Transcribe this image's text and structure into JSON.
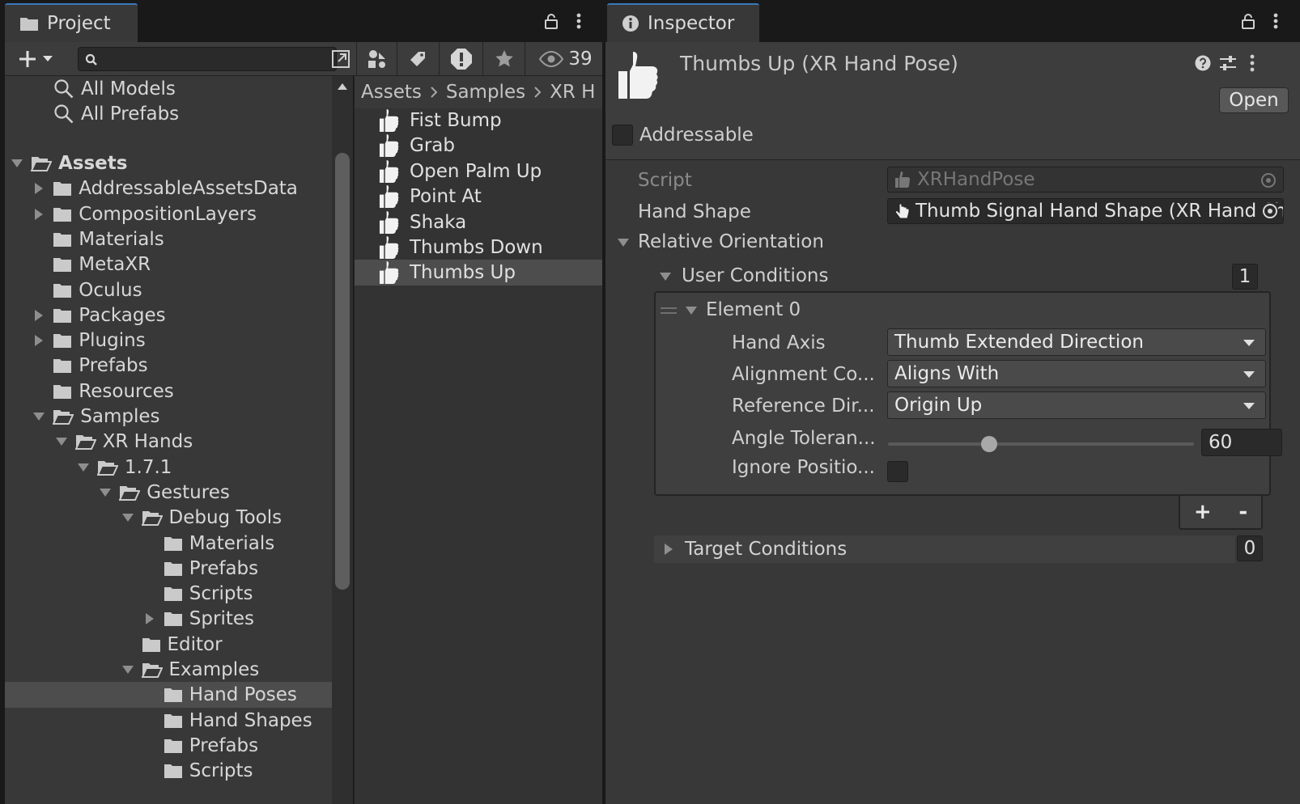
{
  "project": {
    "tab_label": "Project",
    "search": {
      "value": "",
      "placeholder": ""
    },
    "hidden_count": "39",
    "search_items": [
      {
        "label": "All Models"
      },
      {
        "label": "All Prefabs"
      }
    ],
    "tree": [
      {
        "label": "Assets",
        "depth": 0,
        "expand": "open",
        "bold": true
      },
      {
        "label": "AddressableAssetsData",
        "depth": 1,
        "expand": "closed"
      },
      {
        "label": "CompositionLayers",
        "depth": 1,
        "expand": "closed"
      },
      {
        "label": "Materials",
        "depth": 1,
        "expand": "none"
      },
      {
        "label": "MetaXR",
        "depth": 1,
        "expand": "none"
      },
      {
        "label": "Oculus",
        "depth": 1,
        "expand": "none"
      },
      {
        "label": "Packages",
        "depth": 1,
        "expand": "closed"
      },
      {
        "label": "Plugins",
        "depth": 1,
        "expand": "closed"
      },
      {
        "label": "Prefabs",
        "depth": 1,
        "expand": "none"
      },
      {
        "label": "Resources",
        "depth": 1,
        "expand": "none"
      },
      {
        "label": "Samples",
        "depth": 1,
        "expand": "open"
      },
      {
        "label": "XR Hands",
        "depth": 2,
        "expand": "open"
      },
      {
        "label": "1.7.1",
        "depth": 3,
        "expand": "open"
      },
      {
        "label": "Gestures",
        "depth": 4,
        "expand": "open"
      },
      {
        "label": "Debug Tools",
        "depth": 5,
        "expand": "open"
      },
      {
        "label": "Materials",
        "depth": 6,
        "expand": "none"
      },
      {
        "label": "Prefabs",
        "depth": 6,
        "expand": "none"
      },
      {
        "label": "Scripts",
        "depth": 6,
        "expand": "none"
      },
      {
        "label": "Sprites",
        "depth": 6,
        "expand": "closed"
      },
      {
        "label": "Editor",
        "depth": 5,
        "expand": "none"
      },
      {
        "label": "Examples",
        "depth": 5,
        "expand": "open"
      },
      {
        "label": "Hand Poses",
        "depth": 6,
        "expand": "none",
        "selected": true
      },
      {
        "label": "Hand Shapes",
        "depth": 6,
        "expand": "none"
      },
      {
        "label": "Prefabs",
        "depth": 6,
        "expand": "none"
      },
      {
        "label": "Scripts",
        "depth": 6,
        "expand": "none"
      }
    ],
    "breadcrumb": [
      "Assets",
      "Samples",
      "XR H"
    ],
    "assets": [
      {
        "label": "Fist Bump"
      },
      {
        "label": "Grab"
      },
      {
        "label": "Open Palm Up"
      },
      {
        "label": "Point At"
      },
      {
        "label": "Shaka"
      },
      {
        "label": "Thumbs Down"
      },
      {
        "label": "Thumbs Up",
        "selected": true
      }
    ]
  },
  "inspector": {
    "tab_label": "Inspector",
    "title": "Thumbs Up (XR Hand Pose)",
    "open_label": "Open",
    "addressable_label": "Addressable",
    "script_label": "Script",
    "script_value": "XRHandPose",
    "hand_shape_label": "Hand Shape",
    "hand_shape_value": "Thumb Signal Hand Shape (XR Hand Shape)",
    "relative_orientation_label": "Relative Orientation",
    "user_conditions_label": "User Conditions",
    "user_conditions_count": "1",
    "element_label": "Element 0",
    "hand_axis_label": "Hand Axis",
    "hand_axis_value": "Thumb Extended Direction",
    "alignment_label": "Alignment Co...",
    "alignment_value": "Aligns With",
    "reference_label": "Reference Dir...",
    "reference_value": "Origin Up",
    "angle_label": "Angle Toleran...",
    "angle_value": "60",
    "angle_fraction": 0.33,
    "ignore_label": "Ignore Positio...",
    "add_label": "+",
    "remove_label": "-",
    "target_conditions_label": "Target Conditions",
    "target_conditions_count": "0"
  }
}
